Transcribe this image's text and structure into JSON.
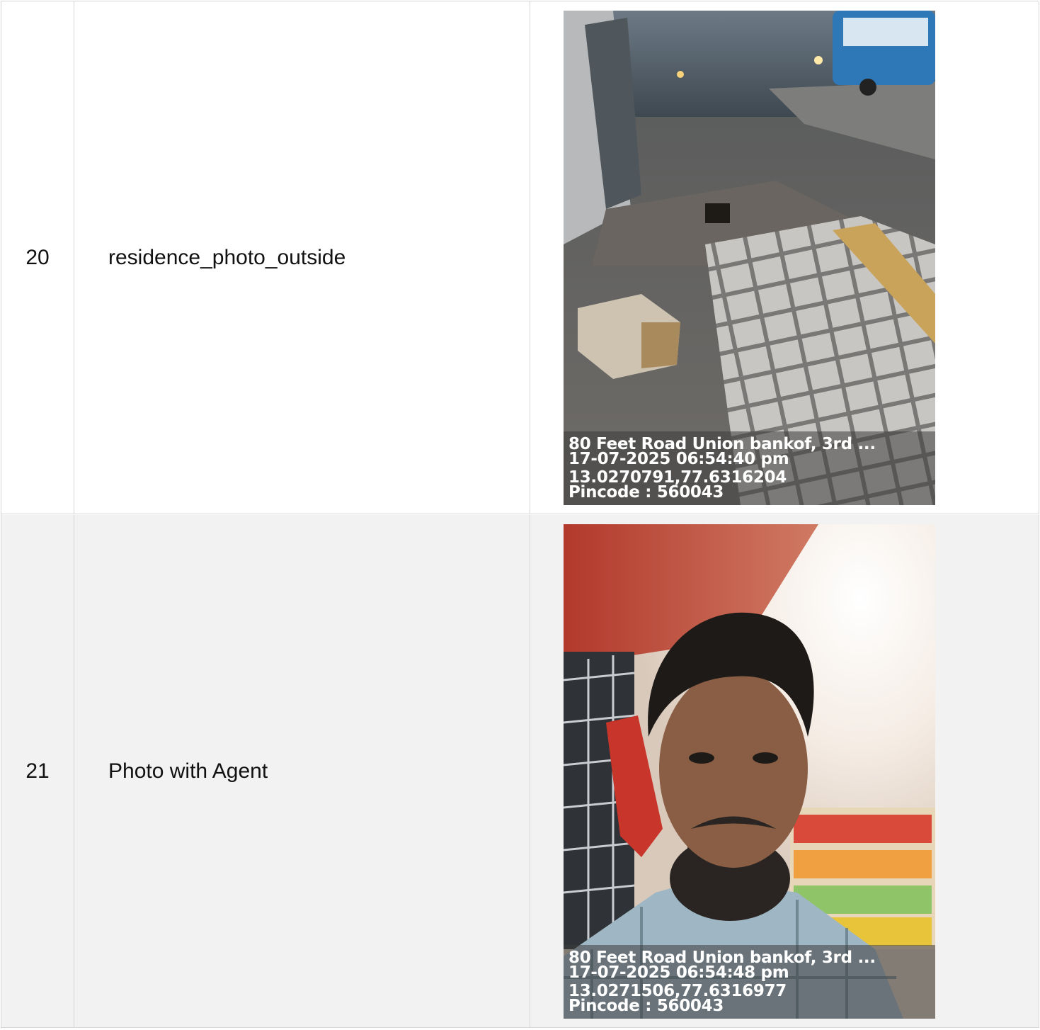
{
  "rows": [
    {
      "number": "20",
      "name": "residence_photo_outside",
      "photo": {
        "icon": "street-photo",
        "stamp": {
          "address": "80 Feet Road Union bankof, 3rd ...",
          "datetime": "17-07-2025 06:54:40 pm",
          "coords": "13.0270791,77.6316204",
          "pincode": "Pincode : 560043"
        }
      }
    },
    {
      "number": "21",
      "name": "Photo with Agent",
      "photo": {
        "icon": "selfie-photo",
        "stamp": {
          "address": "80 Feet Road Union bankof, 3rd ...",
          "datetime": "17-07-2025 06:54:48 pm",
          "coords": "13.0271506,77.6316977",
          "pincode": "Pincode : 560043"
        }
      }
    }
  ]
}
